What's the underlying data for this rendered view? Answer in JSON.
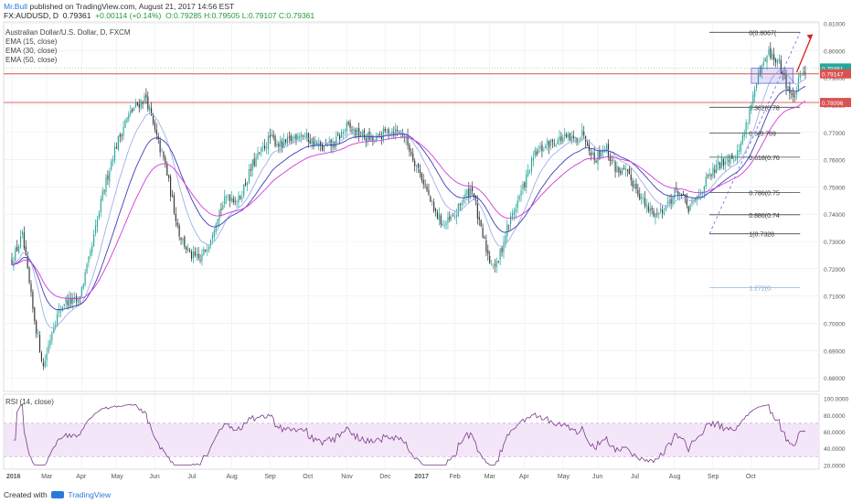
{
  "header": {
    "author": "Mr.Bull",
    "published": "published on TradingView.com, August 21, 2017 14:56 EST",
    "symbol_line": "FX:AUDUSD, D",
    "price": "0.79361",
    "change": "+0.00114 (+0.14%)",
    "ohlc": "O:0.79285 H:0.79505 L:0.79107 C:0.79361"
  },
  "legend": {
    "title": "Australian Dollar/U.S. Dollar, D, FXCM",
    "ema15": "EMA (15, close)",
    "ema30": "EMA (30, close)",
    "ema50": "EMA (50, close)"
  },
  "rsi_label": "RSI (14, close)",
  "footer": {
    "created": "Created with",
    "brand": "TradingView"
  },
  "colors": {
    "up": "#26a69a",
    "down": "#333333",
    "ema15": "#9fb0e8",
    "ema30": "#3d3fb5",
    "ema50": "#d23ad8",
    "hline": "#d9534f",
    "fib": "#444444",
    "fib_ext": "#7fa8d8",
    "arrow": "#d82020",
    "rsi": "#7a3a8a",
    "rsi_band": "#f3e6f8"
  },
  "chart_data": {
    "type": "candlestick",
    "symbol": "AUDUSD",
    "ylim": [
      0.675,
      0.8105
    ],
    "price_ticks": [
      "0.81000",
      "0.80000",
      "0.79000",
      "0.78000",
      "0.77000",
      "0.76000",
      "0.75000",
      "0.74000",
      "0.73000",
      "0.72000",
      "0.71000",
      "0.70000",
      "0.69000",
      "0.68000"
    ],
    "price_tick_values": [
      0.81,
      0.8,
      0.79,
      0.78,
      0.77,
      0.76,
      0.75,
      0.74,
      0.73,
      0.72,
      0.71,
      0.7,
      0.69,
      0.68
    ],
    "x_labels": [
      "2016",
      "Mar",
      "Apr",
      "May",
      "Jun",
      "Jul",
      "Aug",
      "Sep",
      "Oct",
      "Nov",
      "Dec",
      "2017",
      "Feb",
      "Mar",
      "Apr",
      "May",
      "Jun",
      "Jul",
      "Aug",
      "Sep",
      "Oct"
    ],
    "x_label_index": [
      0,
      20,
      40,
      60,
      82,
      104,
      126,
      148,
      170,
      192,
      214,
      234,
      254,
      274,
      294,
      316,
      336,
      358,
      380,
      402,
      424
    ],
    "path_points": [
      [
        0,
        0.723
      ],
      [
        6,
        0.732
      ],
      [
        12,
        0.705
      ],
      [
        18,
        0.684
      ],
      [
        24,
        0.7
      ],
      [
        30,
        0.708
      ],
      [
        38,
        0.708
      ],
      [
        45,
        0.725
      ],
      [
        52,
        0.747
      ],
      [
        58,
        0.762
      ],
      [
        65,
        0.774
      ],
      [
        70,
        0.779
      ],
      [
        77,
        0.783
      ],
      [
        82,
        0.77
      ],
      [
        88,
        0.758
      ],
      [
        92,
        0.745
      ],
      [
        96,
        0.733
      ],
      [
        102,
        0.725
      ],
      [
        108,
        0.723
      ],
      [
        113,
        0.73
      ],
      [
        118,
        0.74
      ],
      [
        124,
        0.747
      ],
      [
        130,
        0.745
      ],
      [
        138,
        0.758
      ],
      [
        148,
        0.768
      ],
      [
        155,
        0.765
      ],
      [
        165,
        0.77
      ],
      [
        178,
        0.764
      ],
      [
        185,
        0.766
      ],
      [
        192,
        0.772
      ],
      [
        200,
        0.769
      ],
      [
        208,
        0.767
      ],
      [
        216,
        0.771
      ],
      [
        224,
        0.77
      ],
      [
        230,
        0.761
      ],
      [
        236,
        0.752
      ],
      [
        242,
        0.741
      ],
      [
        248,
        0.736
      ],
      [
        254,
        0.739
      ],
      [
        258,
        0.745
      ],
      [
        264,
        0.75
      ],
      [
        268,
        0.736
      ],
      [
        274,
        0.723
      ],
      [
        278,
        0.721
      ],
      [
        284,
        0.735
      ],
      [
        292,
        0.748
      ],
      [
        300,
        0.762
      ],
      [
        308,
        0.766
      ],
      [
        316,
        0.768
      ],
      [
        322,
        0.767
      ],
      [
        328,
        0.77
      ],
      [
        334,
        0.76
      ],
      [
        340,
        0.765
      ],
      [
        346,
        0.757
      ],
      [
        352,
        0.755
      ],
      [
        358,
        0.75
      ],
      [
        364,
        0.742
      ],
      [
        370,
        0.74
      ],
      [
        376,
        0.744
      ],
      [
        382,
        0.749
      ],
      [
        388,
        0.742
      ],
      [
        392,
        0.745
      ],
      [
        398,
        0.752
      ],
      [
        404,
        0.757
      ],
      [
        410,
        0.761
      ],
      [
        416,
        0.762
      ],
      [
        420,
        0.77
      ],
      [
        424,
        0.781
      ],
      [
        428,
        0.79
      ],
      [
        434,
        0.799
      ],
      [
        440,
        0.795
      ],
      [
        444,
        0.788
      ],
      [
        448,
        0.782
      ],
      [
        452,
        0.79
      ],
      [
        455,
        0.7936
      ]
    ],
    "hlines": [
      {
        "label": "0.79147",
        "value": 0.79147
      },
      {
        "label": "0.78096",
        "value": 0.78096
      }
    ],
    "last_price": {
      "label": "0.79361",
      "value": 0.79361
    },
    "fibonacci": [
      {
        "label": "0(0.8067(",
        "value": 0.8067
      },
      {
        "label": "0.382(0.78",
        "value": 0.7792
      },
      {
        "label": "0.5(0.769",
        "value": 0.7697
      },
      {
        "label": "0.618(0.76",
        "value": 0.7609
      },
      {
        "label": "0.786(0.75",
        "value": 0.748
      },
      {
        "label": "0.886(0.74",
        "value": 0.7398
      },
      {
        "label": "1(0.7328",
        "value": 0.7328
      },
      {
        "label": "1.272(0.",
        "value": 0.713
      }
    ],
    "rsi": {
      "ylim": [
        15,
        105
      ],
      "ticks": [
        "100.0000",
        "80.0000",
        "60.0000",
        "40.0000",
        "20.0000"
      ],
      "tick_values": [
        100,
        80,
        60,
        40,
        20
      ],
      "bands": [
        70,
        30
      ]
    }
  }
}
